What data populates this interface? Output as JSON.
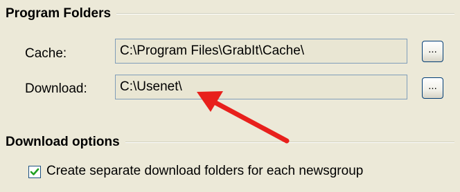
{
  "program_folders": {
    "title": "Program Folders",
    "cache": {
      "label": "Cache:",
      "value": "C:\\Program Files\\GrabIt\\Cache\\",
      "browse_label": "..."
    },
    "download": {
      "label": "Download:",
      "value": "C:\\Usenet\\",
      "browse_label": "..."
    }
  },
  "download_options": {
    "title": "Download options",
    "separate_folders": {
      "label": "Create separate download folders for each newsgroup",
      "checked": true
    }
  },
  "annotation": {
    "arrow_color": "#e8201c",
    "icon": "red-arrow-icon"
  },
  "colors": {
    "background": "#ece9d8",
    "field_background": "#e9e6d3",
    "field_border": "#7f9db9",
    "check_mark": "#21a121"
  }
}
